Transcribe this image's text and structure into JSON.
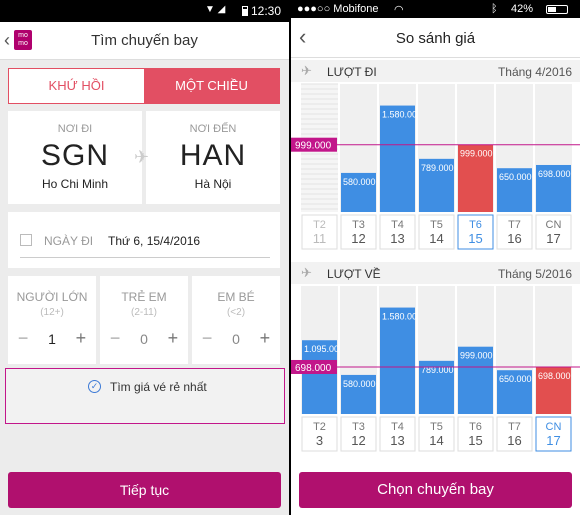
{
  "left": {
    "status": {
      "time": "12:30"
    },
    "header": {
      "back_icon": "chevron-left-icon",
      "logo": "mo mo",
      "title": "Tìm chuyến bay"
    },
    "trip_type": {
      "round_trip": "KHỨ HỒI",
      "one_way": "MỘT CHIỀU",
      "selected": "one_way"
    },
    "route": {
      "from": {
        "label": "NƠI ĐI",
        "code": "SGN",
        "city": "Ho Chi Minh"
      },
      "to": {
        "label": "NƠI ĐẾN",
        "code": "HAN",
        "city": "Hà Nội"
      }
    },
    "date": {
      "label": "NGÀY ĐI",
      "value": "Thứ 6, 15/4/2016"
    },
    "passengers": [
      {
        "label": "NGƯỜI LỚN",
        "range": "(12+)",
        "count": "1"
      },
      {
        "label": "TRẺ EM",
        "range": "(2-11)",
        "count": "0"
      },
      {
        "label": "EM BÉ",
        "range": "(<2)",
        "count": "0"
      }
    ],
    "cheapest": {
      "label": "Tìm giá vé rẻ nhất",
      "checked": true
    },
    "continue_label": "Tiếp tục"
  },
  "right": {
    "status": {
      "carrier": "●●●○○ Mobifone",
      "battery": "42%"
    },
    "header": {
      "back_icon": "chevron-left-icon",
      "title": "So sánh giá"
    },
    "choose_label": "Chọn chuyến bay",
    "colors": {
      "bar": "#3f8ee3",
      "selected": "#e24f4f",
      "line": "#c2168a",
      "disabled": "#e6e6e6"
    }
  },
  "chart_data": [
    {
      "type": "bar",
      "title": "LƯỢT ĐI",
      "month": "Tháng 4/2016",
      "categories": [
        {
          "day": "T2",
          "date": "11"
        },
        {
          "day": "T3",
          "date": "12"
        },
        {
          "day": "T4",
          "date": "13"
        },
        {
          "day": "T5",
          "date": "14"
        },
        {
          "day": "T6",
          "date": "15"
        },
        {
          "day": "T7",
          "date": "16"
        },
        {
          "day": "CN",
          "date": "17"
        }
      ],
      "values": [
        null,
        580,
        1580,
        789,
        999,
        650,
        698
      ],
      "labels": [
        "",
        "580.000",
        "1.580.000",
        "789.000",
        "999.000",
        "650.000",
        "698.000"
      ],
      "selected_index": 4,
      "disabled_index": 0,
      "reference": {
        "value": 999,
        "label": "999.000"
      },
      "ylim": [
        0,
        1900
      ]
    },
    {
      "type": "bar",
      "title": "LƯỢT VỀ",
      "month": "Tháng 5/2016",
      "categories": [
        {
          "day": "T2",
          "date": "3"
        },
        {
          "day": "T3",
          "date": "12"
        },
        {
          "day": "T4",
          "date": "13"
        },
        {
          "day": "T5",
          "date": "14"
        },
        {
          "day": "T6",
          "date": "15"
        },
        {
          "day": "T7",
          "date": "16"
        },
        {
          "day": "CN",
          "date": "17"
        }
      ],
      "values": [
        1095,
        580,
        1580,
        789,
        999,
        650,
        698
      ],
      "labels": [
        "1.095.000",
        "580.000",
        "1.580.000",
        "789.000",
        "999.000",
        "650.000",
        "698.000"
      ],
      "selected_index": 6,
      "disabled_index": -1,
      "reference": {
        "value": 698,
        "label": "698.000"
      },
      "ylim": [
        0,
        1900
      ]
    }
  ]
}
